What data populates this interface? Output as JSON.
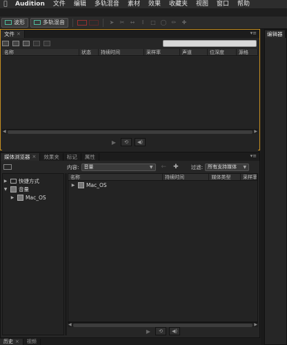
{
  "menubar": {
    "app_name": "Audition",
    "items": [
      "文件",
      "编辑",
      "多轨混音",
      "素材",
      "效果",
      "收藏夹",
      "视图",
      "窗口",
      "帮助"
    ]
  },
  "toolbar": {
    "waveform_label": "波形",
    "multitrack_label": "多轨混音"
  },
  "files_panel": {
    "tab_label": "文件",
    "search_placeholder": "",
    "columns": [
      "名称",
      "状态",
      "持续时间",
      "采样率",
      "声道",
      "位深度",
      "源格"
    ]
  },
  "media_panel": {
    "tabs": [
      "媒体浏览器",
      "效果夹",
      "标记",
      "属性"
    ],
    "content_label": "内容:",
    "content_value": "音量",
    "filter_label": "过滤:",
    "filter_value": "所有支持媒体",
    "tree": [
      {
        "label": "快捷方式",
        "level": 0
      },
      {
        "label": "音量",
        "level": 0
      },
      {
        "label": "Mac_OS",
        "level": 1
      }
    ],
    "list_columns": [
      "名称",
      "持续时间",
      "媒体类型",
      "采样率"
    ],
    "list_rows": [
      "Mac_OS"
    ]
  },
  "bottom_tabs": [
    "历史",
    "视频"
  ],
  "editor_panel": {
    "tab_label": "编辑器"
  }
}
